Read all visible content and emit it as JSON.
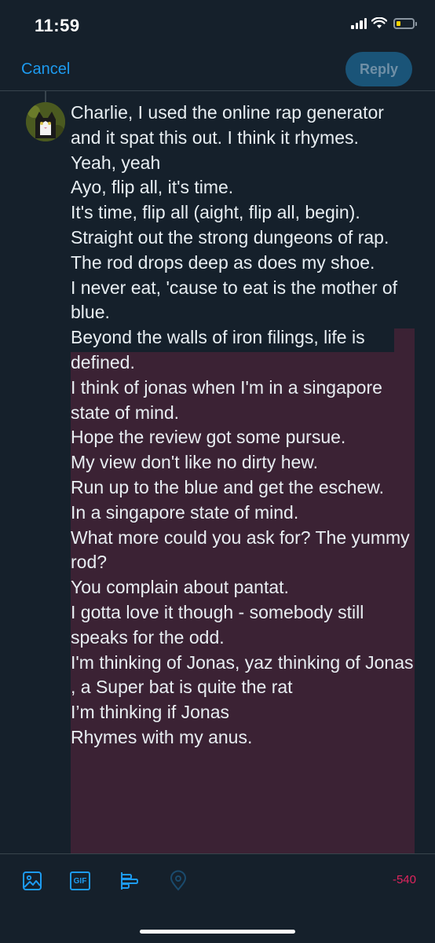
{
  "status": {
    "time": "11:59"
  },
  "nav": {
    "cancel_label": "Cancel",
    "reply_label": "Reply"
  },
  "compose": {
    "text": "Charlie, I used the online rap generator and it spat this out. I think it rhymes.\nYeah, yeah\nAyo, flip all, it's time.\nIt's time, flip all (aight, flip all, begin).\nStraight out the strong dungeons of rap.\nThe rod drops deep as does my shoe.\nI never eat, 'cause to eat is the mother of blue.\nBeyond the walls of iron filings, life is defined.\nI think of jonas when I'm in a singapore state of mind.\nHope the review got some pursue.\nMy view don't like no dirty hew.\nRun up to the blue and get the eschew.\nIn a singapore state of mind.\nWhat more could you ask for? The yummy rod?\nYou complain about pantat.\nI gotta love it though - somebody still speaks for the odd.\nI'm thinking of Jonas, yaz thinking of Jonas , a Super bat is quite the rat\nI’m thinking if Jonas\nRhymes with my anus.",
    "over_limit_color": "#3b2234"
  },
  "toolbar": {
    "icons": [
      "image-icon",
      "gif-icon",
      "poll-icon",
      "location-icon"
    ],
    "gif_label": "GIF",
    "char_count": "-540",
    "accent_color": "#1d9bf0",
    "error_color": "#e0245e"
  }
}
